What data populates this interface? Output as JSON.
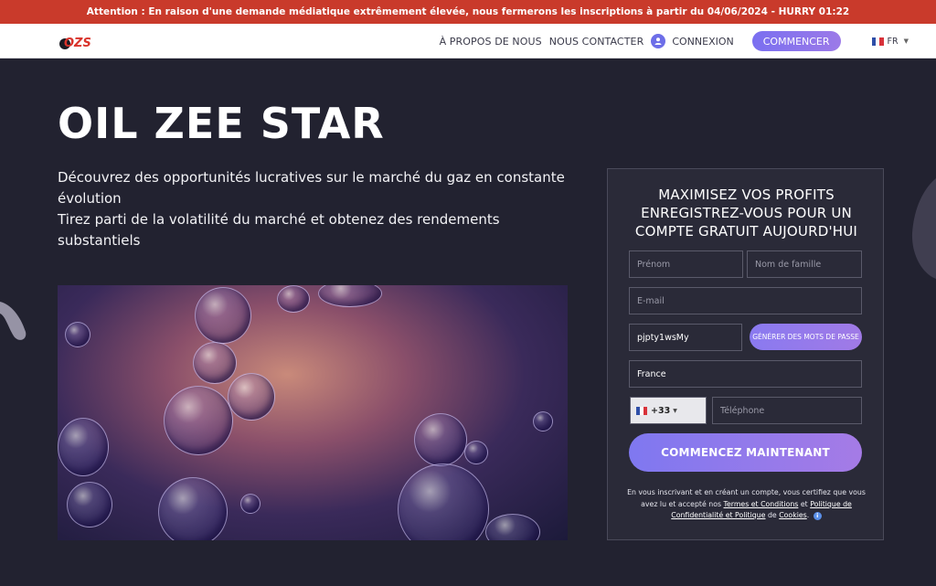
{
  "alert": {
    "text": "Attention : En raison d'une demande médiatique extrêmement élevée, nous fermerons les inscriptions à partir du 04/06/2024 - HURRY 01:22"
  },
  "header": {
    "logo_text": "OZS",
    "nav": {
      "about": "À PROPOS DE NOUS",
      "contact": "NOUS CONTACTER",
      "login": "CONNEXION",
      "start": "COMMENCER"
    },
    "language": "FR"
  },
  "hero": {
    "title": "OIL ZEE STAR",
    "subtitle_line1": "Découvrez des opportunités lucratives sur le marché du gaz en constante évolution",
    "subtitle_line2": "Tirez parti de la volatilité du marché et obtenez des rendements substantiels"
  },
  "form": {
    "title": "MAXIMISEZ VOS PROFITS ENREGISTREZ-VOUS POUR UN COMPTE GRATUIT AUJOURD'HUI",
    "first_name_placeholder": "Prénom",
    "last_name_placeholder": "Nom de famille",
    "email_placeholder": "E-mail",
    "password_value": "pjpty1wsMy",
    "generate_button": "GÉNÉRER DES MOTS DE PASSE",
    "country_value": "France",
    "phone_prefix": "+33",
    "phone_placeholder": "Téléphone",
    "submit_button": "COMMENCEZ MAINTENANT",
    "disclaimer": {
      "part1": "En vous inscrivant et en créant un compte, vous certifiez que vous avez lu et accepté nos",
      "terms_link": "Termes et Conditions",
      "and": "et",
      "privacy_link": "Politique de Confidentialité et Politique",
      "of": "de",
      "cookies_link": "Cookies",
      "end": "."
    }
  },
  "colors": {
    "alert_bg": "#c93a2b",
    "page_bg": "#222230",
    "accent": "#8a7af0"
  }
}
